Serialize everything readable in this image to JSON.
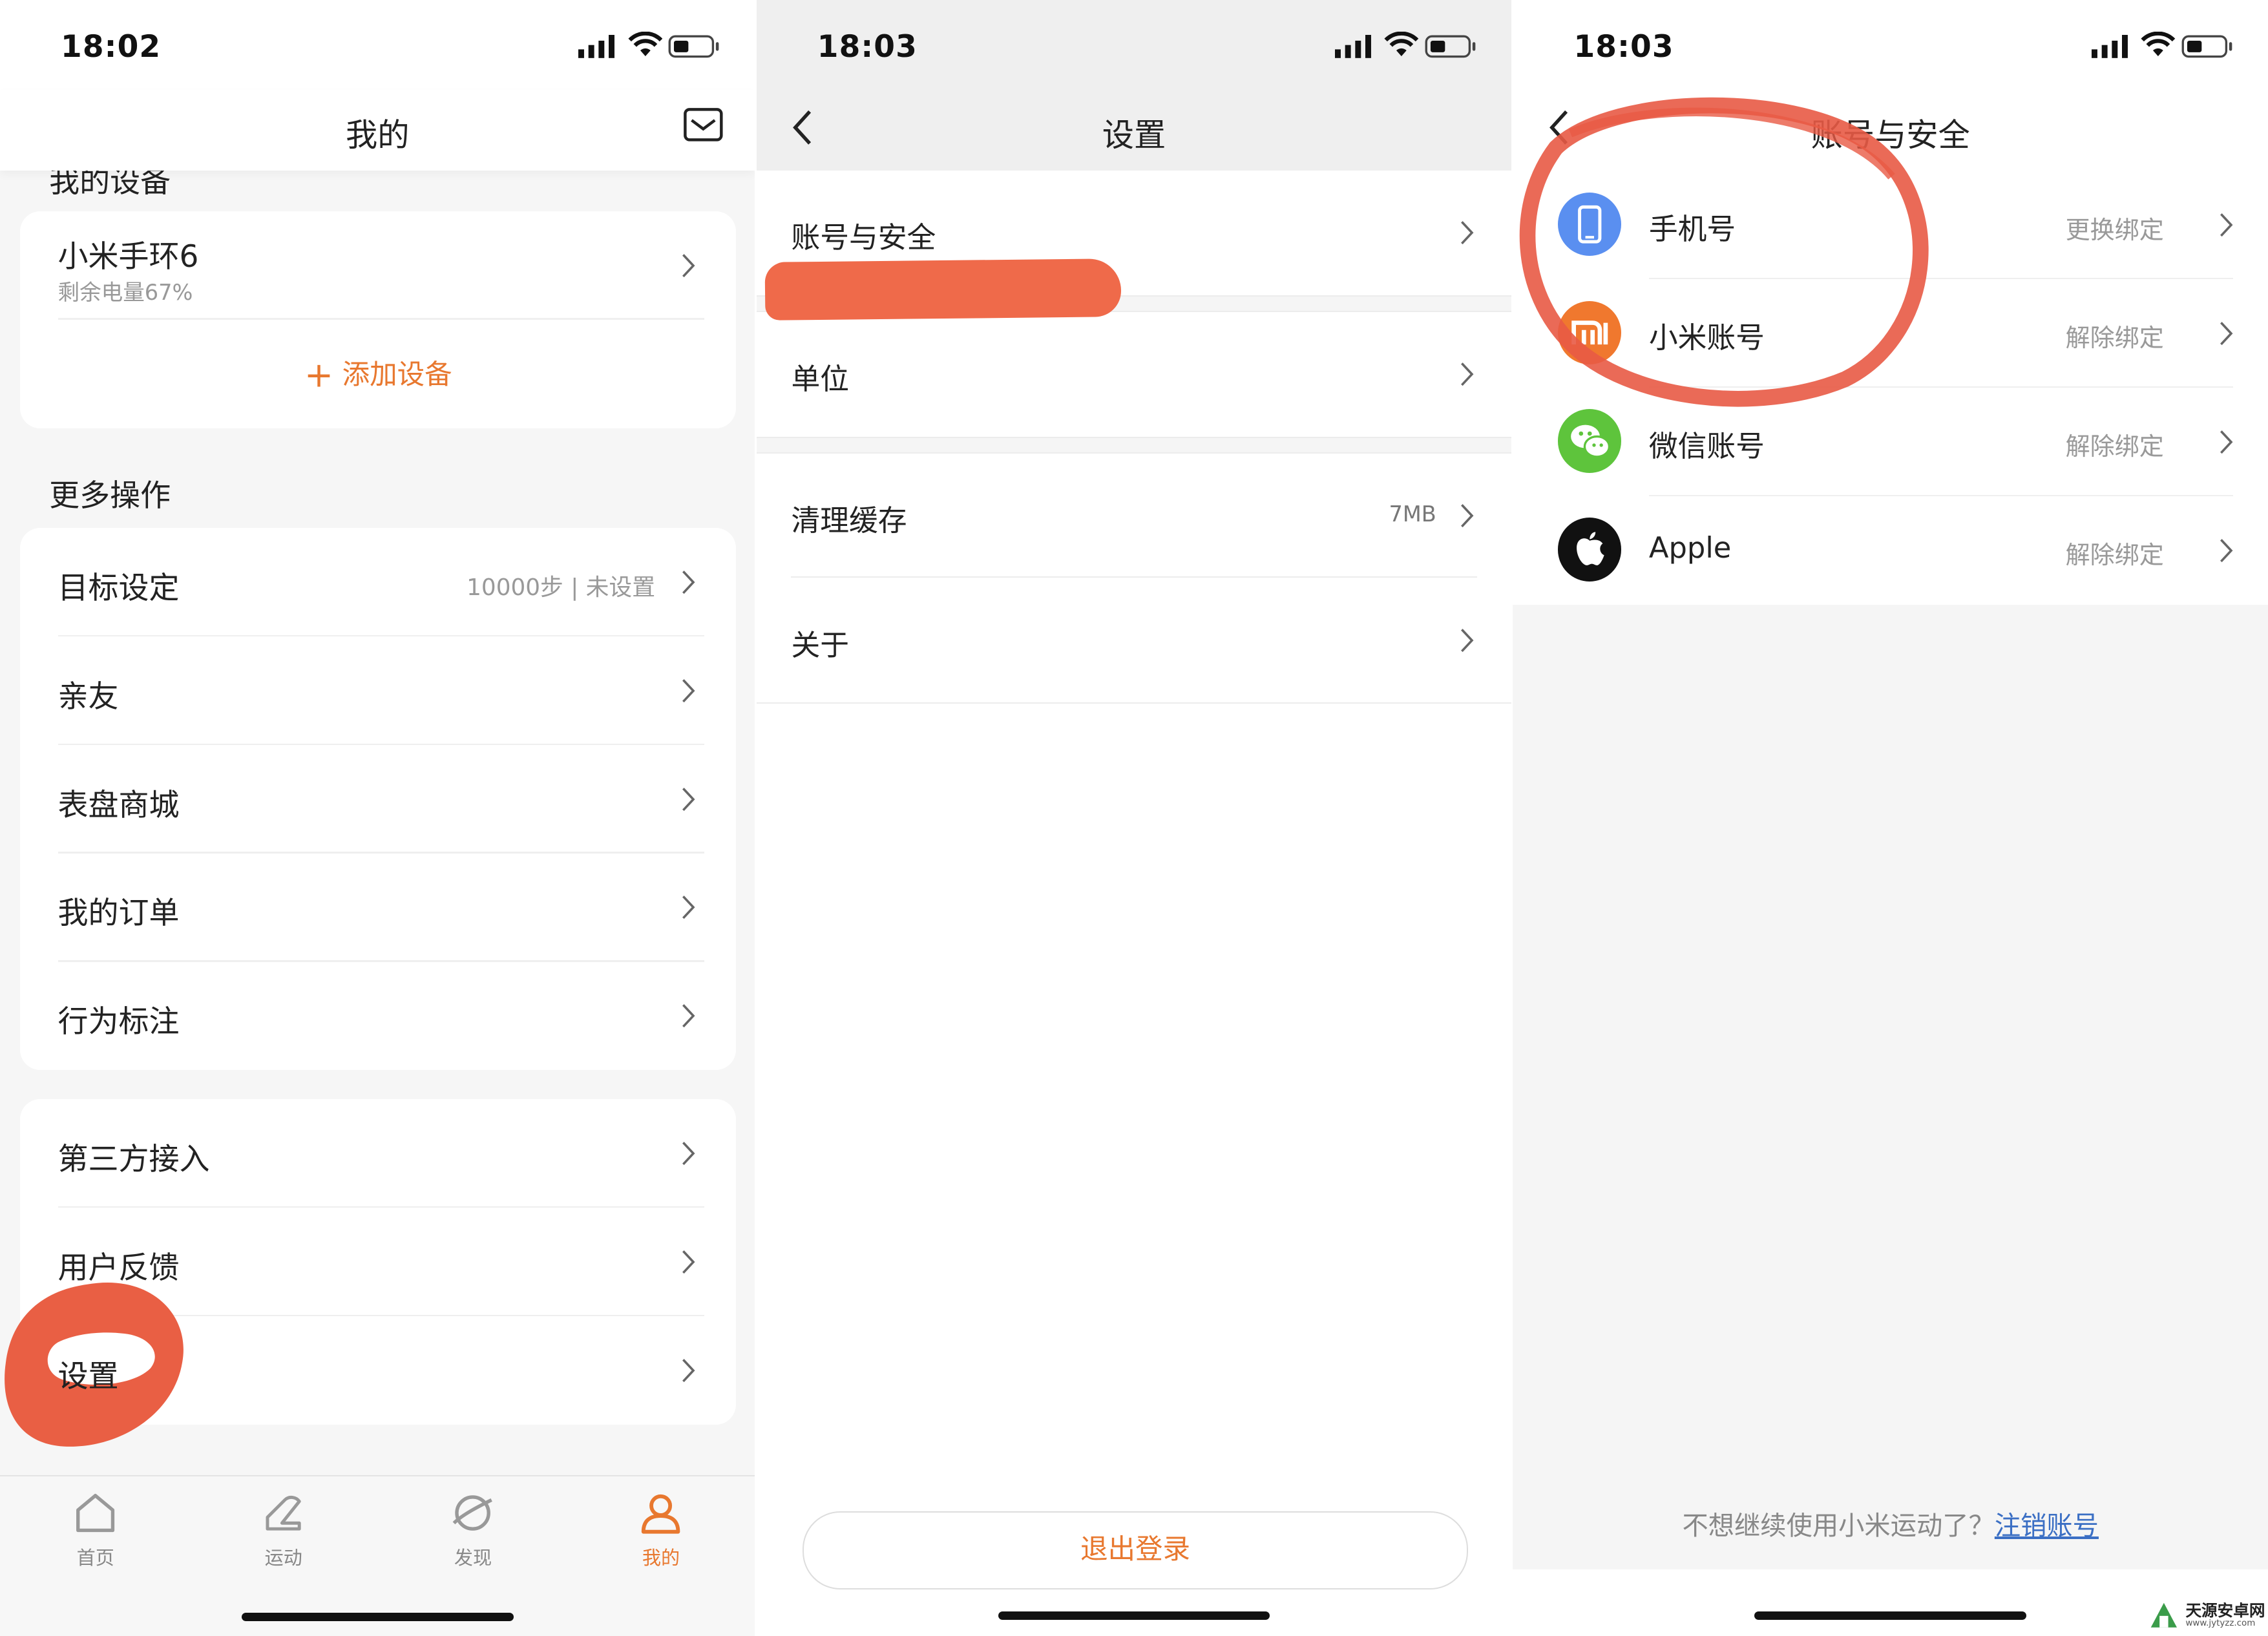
{
  "panel1": {
    "time": "18:02",
    "title": "我的",
    "devices_heading": "我的设备",
    "device_name": "小米手环6",
    "device_battery": "剩余电量67%",
    "add_device": "添加设备",
    "more_heading": "更多操作",
    "menu1": [
      {
        "label": "目标设定",
        "value": "10000步 | 未设置"
      },
      {
        "label": "亲友"
      },
      {
        "label": "表盘商城"
      },
      {
        "label": "我的订单"
      },
      {
        "label": "行为标注"
      }
    ],
    "menu2": [
      {
        "label": "第三方接入"
      },
      {
        "label": "用户反馈"
      },
      {
        "label": "设置"
      }
    ],
    "tabs": [
      {
        "label": "首页",
        "icon": "home-icon"
      },
      {
        "label": "运动",
        "icon": "shoe-icon"
      },
      {
        "label": "发现",
        "icon": "planet-icon"
      },
      {
        "label": "我的",
        "icon": "person-icon"
      }
    ],
    "accent": "#e8782f",
    "annotation_color": "#e8563a"
  },
  "panel2": {
    "time": "18:03",
    "title": "设置",
    "rows": [
      {
        "label": "账号与安全"
      },
      {
        "label": "单位"
      },
      {
        "label": "清理缓存",
        "value": "7MB"
      },
      {
        "label": "关于"
      }
    ],
    "logout": "退出登录"
  },
  "panel3": {
    "time": "18:03",
    "title": "账号与安全",
    "accounts": [
      {
        "label": "手机号",
        "action": "更换绑定",
        "icon": "phone-icon",
        "color": "#5a8ff0"
      },
      {
        "label": "小米账号",
        "action": "解除绑定",
        "icon": "mi-icon",
        "color": "#f0782e"
      },
      {
        "label": "微信账号",
        "action": "解除绑定",
        "icon": "wechat-icon",
        "color": "#5ec43c"
      },
      {
        "label": "Apple",
        "action": "解除绑定",
        "icon": "apple-icon",
        "color": "#111111"
      }
    ],
    "footer_text": "不想继续使用小米运动了？",
    "footer_link": "注销账号",
    "link_color": "#3b6fc4"
  },
  "watermark": {
    "name": "天源安卓网",
    "url": "www.jytyzz.com"
  }
}
